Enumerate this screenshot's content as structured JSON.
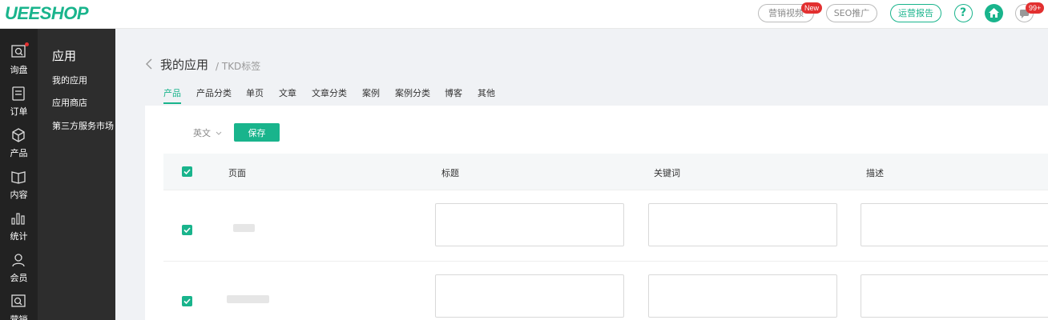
{
  "header": {
    "logo": "UEESHOP",
    "marketing_video": "营销视频",
    "new_badge": "New",
    "seo_promo": "SEO推广",
    "ops_report": "运营报告",
    "help": "?",
    "message_count": "99+"
  },
  "icon_nav": [
    {
      "label": "询盘",
      "icon": "inquiry-icon"
    },
    {
      "label": "订单",
      "icon": "order-icon"
    },
    {
      "label": "产品",
      "icon": "product-icon"
    },
    {
      "label": "内容",
      "icon": "content-icon"
    },
    {
      "label": "统计",
      "icon": "stats-icon"
    },
    {
      "label": "会员",
      "icon": "member-icon"
    },
    {
      "label": "营销",
      "icon": "marketing-icon"
    }
  ],
  "sub_nav": {
    "title": "应用",
    "items": [
      "我的应用",
      "应用商店",
      "第三方服务市场"
    ]
  },
  "page": {
    "title": "我的应用",
    "breadcrumb": "/ TKD标签"
  },
  "tabs": [
    "产品",
    "产品分类",
    "单页",
    "文章",
    "文章分类",
    "案例",
    "案例分类",
    "博客",
    "其他"
  ],
  "toolbar": {
    "language": "英文",
    "save_label": "保存"
  },
  "table": {
    "columns": [
      "页面",
      "标题",
      "关键词",
      "描述"
    ],
    "rows": [
      {
        "checked": true,
        "title": "",
        "keywords": "",
        "description": ""
      },
      {
        "checked": true,
        "title": "",
        "keywords": "",
        "description": ""
      }
    ]
  },
  "colors": {
    "accent": "#19b48c",
    "sidebar": "#222222",
    "subsidebar": "#2d2d2d",
    "badge": "#e23030"
  }
}
